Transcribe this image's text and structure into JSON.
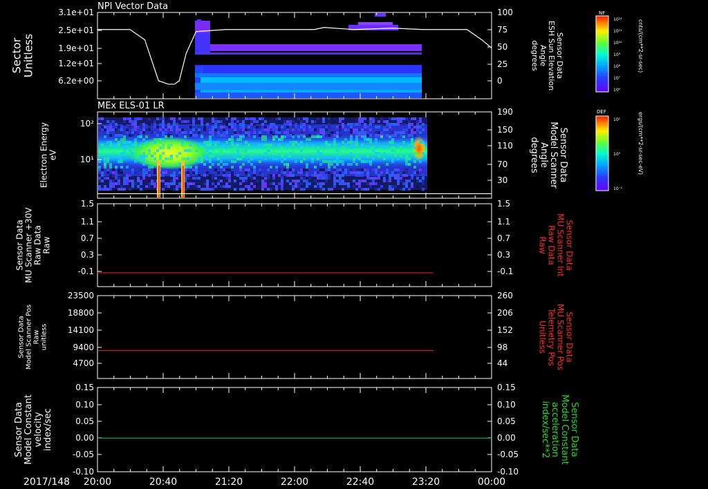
{
  "colors": {
    "background": "#000000",
    "axis": "#ffffff",
    "red_trace": "#ff2020",
    "green_trace": "#22cc22",
    "red_label": "#ff2a2a",
    "green_label": "#22dd22"
  },
  "time_axis": {
    "date_label": "2017/148",
    "ticks": [
      "20:00",
      "20:40",
      "21:20",
      "22:00",
      "22:40",
      "23:20",
      "00:00"
    ],
    "range_hours": [
      20,
      24
    ]
  },
  "colorbars": [
    {
      "id": "nf",
      "title": "NF",
      "units": "cnts/(cm**2-sr-sec)",
      "tick_labels": [
        "10¹²",
        "10¹¹",
        "10¹⁰",
        "10⁹",
        "10⁸",
        "10⁷",
        "10⁶"
      ]
    },
    {
      "id": "def",
      "title": "DEF",
      "units": "ergs/(cm**2-sr-sec-eV)",
      "tick_labels": [
        "10¹",
        "10⁰",
        "10⁻¹"
      ]
    }
  ],
  "chart_data": [
    {
      "id": "p1",
      "type": "heatmap",
      "title": "NPI Vector Data",
      "ylabel": [
        "Sector",
        "Unitless"
      ],
      "yticks": [
        "3.1e+01",
        "2.5e+01",
        "1.9e+01",
        "1.2e+01",
        "6.2e+00"
      ],
      "y2label": [
        "Sensor Data",
        "ESH Sun Elevation",
        "Angle",
        "degrees"
      ],
      "y2ticks": [
        "100",
        "75",
        "50",
        "25",
        "0"
      ],
      "y2lim": [
        -25,
        100
      ],
      "overlay_line": {
        "name": "ESH Sun Elevation Angle",
        "color": "#ffffff",
        "x_hours": [
          20.0,
          20.33,
          20.48,
          20.55,
          20.62,
          20.72,
          20.78,
          20.83,
          20.9,
          21.0,
          21.3,
          21.7,
          22.2,
          22.3,
          22.6,
          23.0,
          23.3,
          23.5,
          23.75,
          23.9,
          24.0
        ],
        "y": [
          75,
          75,
          60,
          30,
          0,
          -5,
          -5,
          0,
          40,
          72,
          75,
          75,
          75,
          78,
          75,
          77,
          75,
          75,
          75,
          60,
          48
        ]
      }
    },
    {
      "id": "p2",
      "type": "heatmap",
      "title": "MEx ELS-01 LR",
      "ylabel": [
        "Electron Energy",
        "eV"
      ],
      "yticks": [
        "10²",
        "10¹"
      ],
      "y2label": [
        "Sensor Data",
        "Model Scanner",
        "Angle",
        "degrees"
      ],
      "y2ticks": [
        "190",
        "150",
        "110",
        "70",
        "30"
      ],
      "y2lim": [
        0,
        190
      ],
      "overlay_line": {
        "name": "Model Scanner Angle",
        "color": "#ffffff",
        "x_hours": [
          20.0,
          24.0
        ],
        "y": [
          10,
          10
        ]
      }
    },
    {
      "id": "p3",
      "type": "line",
      "ylabel": [
        "Sensor Data",
        "MU Scanner +30V",
        "Raw Data",
        "Raw"
      ],
      "yticks": [
        "1.5",
        "1.1",
        "0.7",
        "0.3",
        "-0.1"
      ],
      "ylim": [
        -0.3,
        1.5
      ],
      "y2label": [
        "Sensor Data",
        "MU Scanner Int",
        "Raw Data",
        "Raw"
      ],
      "y2ticks": [
        "1.5",
        "1.1",
        "0.7",
        "0.3",
        "-0.1"
      ],
      "series": [
        {
          "color": "#ff2020",
          "x_hours": [
            20.0,
            23.41
          ],
          "y": [
            0.0,
            0.0
          ]
        }
      ]
    },
    {
      "id": "p4",
      "type": "line",
      "ylabel": [
        "Sensor Data",
        "Model Scanner Pos",
        "Raw",
        "unitless"
      ],
      "yticks": [
        "23500",
        "18800",
        "14100",
        "9400",
        "4700"
      ],
      "ylim": [
        0,
        23500
      ],
      "y2label": [
        "Sensor Data",
        "MU Scanner Pos",
        "Telemetry Pos",
        "Unitless"
      ],
      "y2ticks": [
        "260",
        "206",
        "152",
        "98",
        "44"
      ],
      "series": [
        {
          "color": "#ff2020",
          "x_hours": [
            20.0,
            23.41
          ],
          "y": [
            7900,
            7900
          ]
        }
      ]
    },
    {
      "id": "p5",
      "type": "line",
      "ylabel": [
        "Sensor Data",
        "Model Constant",
        "velocity",
        "index/sec"
      ],
      "yticks": [
        "0.15",
        "0.10",
        "0.05",
        "0.00",
        "-0.05",
        "-0.10"
      ],
      "ylim": [
        -0.1,
        0.15
      ],
      "y2label": [
        "Sensor Data",
        "Model Constant",
        "acceleration",
        "index/sec**2"
      ],
      "y2ticks": [
        "0.15",
        "0.10",
        "0.05",
        "0.00",
        "-0.05",
        "-0.10"
      ],
      "series": [
        {
          "color": "#22cc22",
          "x_hours": [
            20.0,
            24.0
          ],
          "y": [
            0.0,
            0.0
          ]
        }
      ]
    }
  ]
}
